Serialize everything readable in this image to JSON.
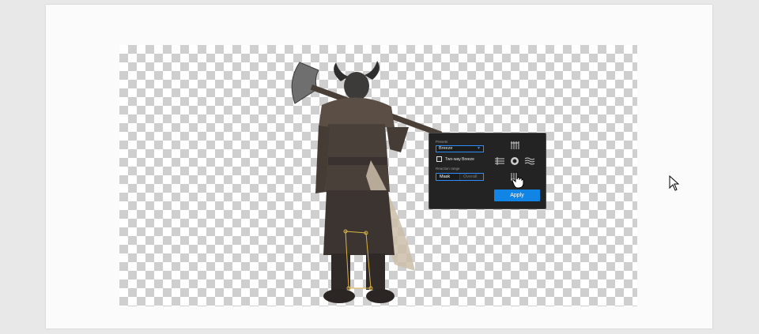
{
  "panel": {
    "presets_label": "Presets",
    "preset_value": "Breeze",
    "two_way_label": "Two-way Breeze",
    "two_way_checked": false,
    "range_label": "Reaction range",
    "range_options": [
      "Mask",
      "Overall"
    ],
    "range_selected": "Mask",
    "apply_label": "Apply",
    "accent_color": "#1185e6"
  },
  "icons": {
    "direction_up": "wind-up-icon",
    "direction_left": "wind-left-icon",
    "center": "center-ring-icon",
    "direction_right": "wind-right-icon",
    "direction_down": "wind-down-icon",
    "hand_cursor": "hand-pointer-icon",
    "arrow_cursor": "arrow-cursor-icon"
  }
}
